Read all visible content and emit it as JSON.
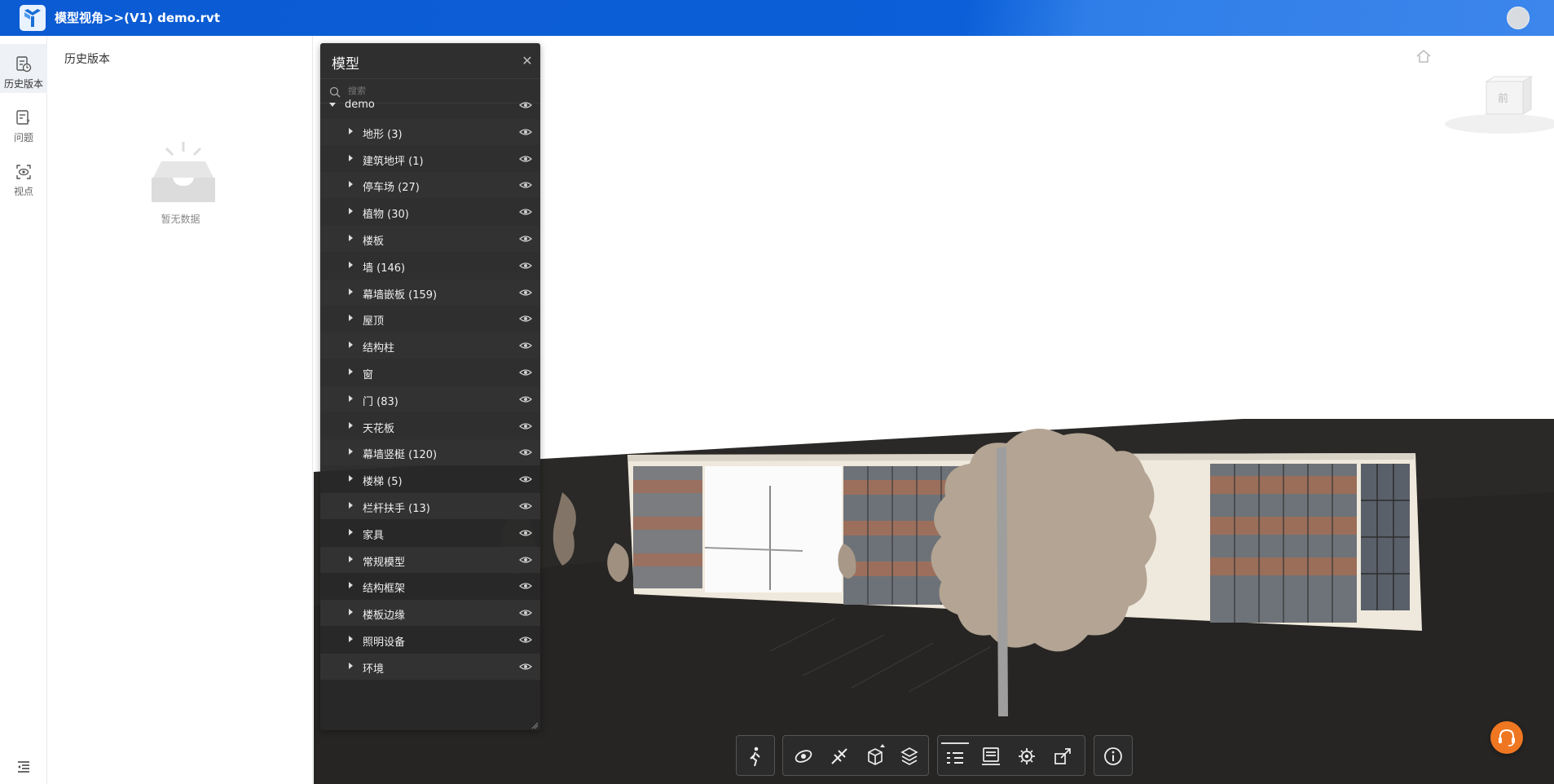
{
  "header": {
    "title": "模型视角>>(V1) demo.rvt",
    "logo_icon": "app-logo-icon",
    "avatar_icon": "user-avatar",
    "colors": {
      "bar": "#0b5bd3",
      "accent": "#3c86ec"
    }
  },
  "rail": {
    "items": [
      {
        "label": "历史版本",
        "icon": "history-version-icon",
        "active": true
      },
      {
        "label": "问题",
        "icon": "issue-icon",
        "active": false
      },
      {
        "label": "视点",
        "icon": "viewpoint-icon",
        "active": false
      }
    ],
    "collapse_icon": "collapse-menu-icon"
  },
  "history_panel": {
    "title": "历史版本",
    "empty_text": "暂无数据",
    "empty_icon": "empty-inbox-icon"
  },
  "model_tree": {
    "title": "模型",
    "close_icon": "close-icon",
    "search_placeholder": "搜索",
    "root": {
      "label": "demo",
      "expanded": true
    },
    "items": [
      {
        "label": "地形 (3)"
      },
      {
        "label": "建筑地坪 (1)"
      },
      {
        "label": "停车场 (27)"
      },
      {
        "label": "植物 (30)"
      },
      {
        "label": "楼板"
      },
      {
        "label": "墙 (146)"
      },
      {
        "label": "幕墙嵌板 (159)"
      },
      {
        "label": "屋顶"
      },
      {
        "label": "结构柱"
      },
      {
        "label": "窗"
      },
      {
        "label": "门 (83)"
      },
      {
        "label": "天花板"
      },
      {
        "label": "幕墙竖梃 (120)"
      },
      {
        "label": "楼梯 (5)"
      },
      {
        "label": "栏杆扶手 (13)"
      },
      {
        "label": "家具"
      },
      {
        "label": "常规模型"
      },
      {
        "label": "结构框架"
      },
      {
        "label": "楼板边缘"
      },
      {
        "label": "照明设备"
      },
      {
        "label": "环境"
      }
    ]
  },
  "viewport": {
    "navcube_label": "前",
    "home_icon": "home-icon"
  },
  "toolbar": {
    "groups": [
      {
        "buttons": [
          "walk-icon"
        ]
      },
      {
        "buttons": [
          "orbit-icon",
          "measure-icon",
          "section-box-icon",
          "layers-icon"
        ]
      },
      {
        "buttons": [
          "model-tree-icon",
          "properties-icon",
          "settings-icon",
          "fullscreen-icon"
        ]
      },
      {
        "buttons": [
          "info-icon"
        ]
      }
    ]
  },
  "support": {
    "icon": "headset-support-icon",
    "color": "#f07722"
  }
}
